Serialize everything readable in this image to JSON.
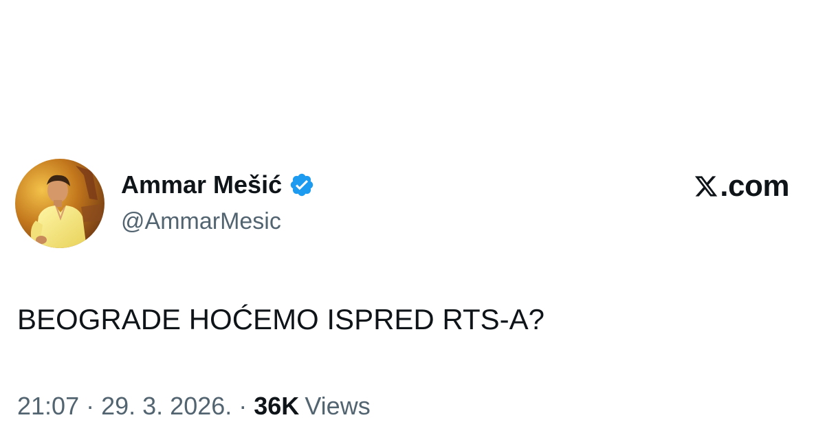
{
  "tweet": {
    "author": {
      "display_name": "Ammar Mešić",
      "handle": "@AmmarMesic",
      "verified": true,
      "avatar_icon": "profile-photo"
    },
    "brand": {
      "logo_icon": "x-logo-icon",
      "domain_label": ".com"
    },
    "text": "BEOGRADE HOĆEMO ISPRED RTS-A?",
    "meta": {
      "time": "21:07",
      "separator": "·",
      "date": "29. 3. 2026.",
      "views_count": "36K",
      "views_label": "Views"
    }
  },
  "colors": {
    "text_primary": "#0f1419",
    "text_secondary": "#536471",
    "verified_blue": "#1d9bf0",
    "background": "#ffffff"
  }
}
